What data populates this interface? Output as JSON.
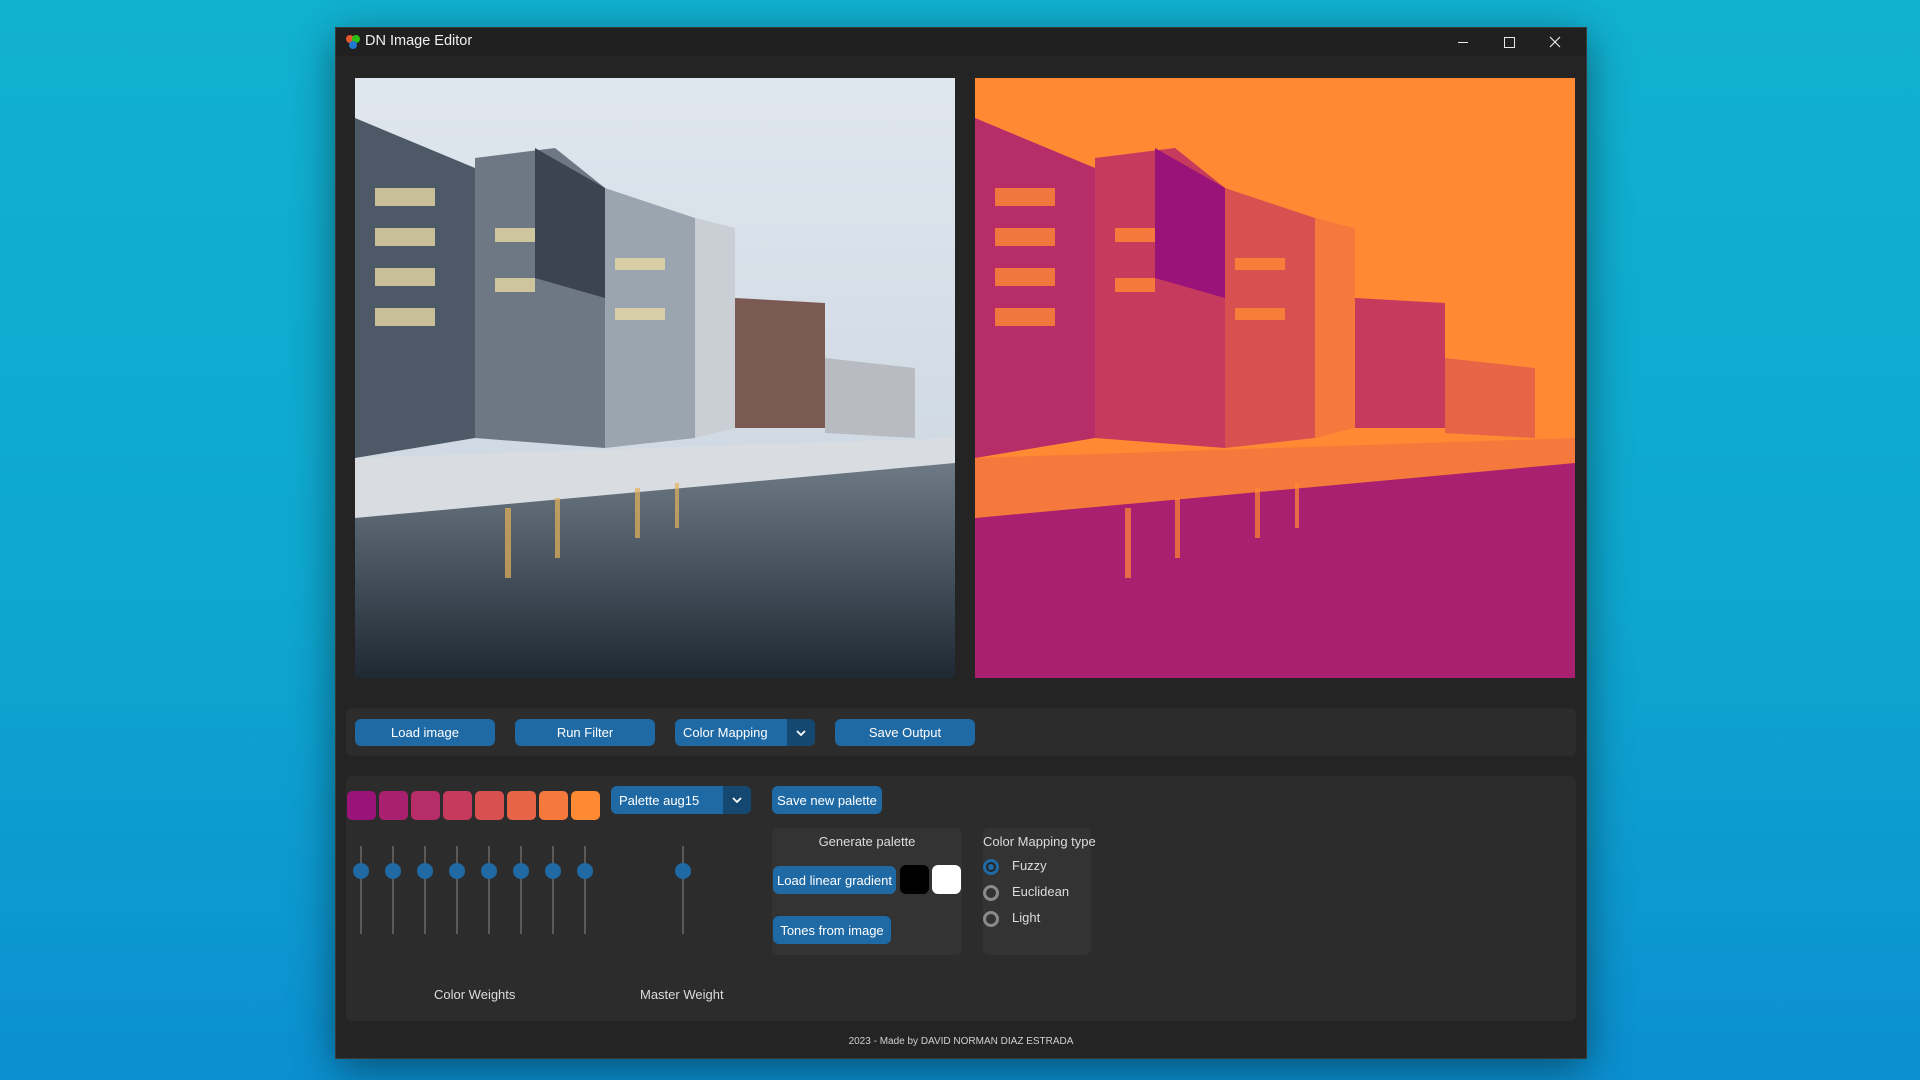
{
  "window": {
    "title": "DN Image Editor"
  },
  "toolbar": {
    "load_image": "Load image",
    "run_filter": "Run Filter",
    "mode_dropdown": "Color Mapping",
    "save_output": "Save Output"
  },
  "palette": {
    "swatches": [
      "#9a1378",
      "#a8206f",
      "#b62d68",
      "#c63a5e",
      "#d85150",
      "#e86447",
      "#f5793c",
      "#ff8a33"
    ],
    "dropdown": "Palette aug15",
    "save_button": "Save new palette"
  },
  "weights": {
    "color_weights_label": "Color Weights",
    "master_weight_label": "Master Weight",
    "color_weight_levels": [
      0.72,
      0.72,
      0.72,
      0.72,
      0.72,
      0.72,
      0.72,
      0.72
    ],
    "master_weight_level": 0.72
  },
  "generate": {
    "title": "Generate palette",
    "load_gradient": "Load linear gradient",
    "tones_from_image": "Tones from image",
    "gradient_start": "#000000",
    "gradient_end": "#ffffff"
  },
  "mapping_type": {
    "title": "Color Mapping type",
    "options": [
      "Fuzzy",
      "Euclidean",
      "Light"
    ],
    "selected": "Fuzzy"
  },
  "footer": "2023 - Made by DAVID NORMAN DIAZ ESTRADA",
  "colors": {
    "accent": "#1f6aa5",
    "panel": "#2c2c2c",
    "background": "#242424"
  }
}
